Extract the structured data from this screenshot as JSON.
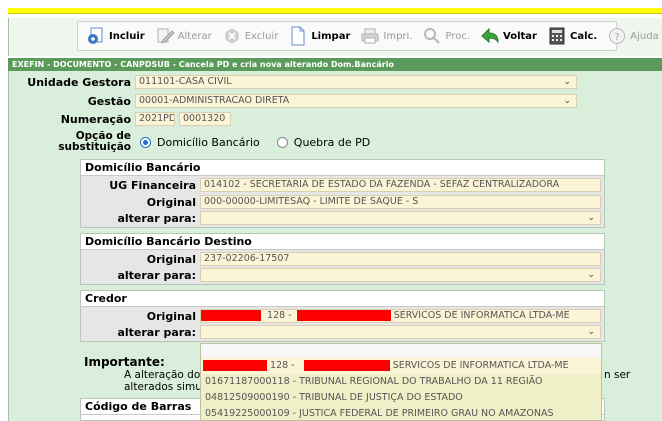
{
  "toolbar": {
    "buttons": [
      {
        "label": "Incluir",
        "icon": "add-document-icon",
        "enabled": true
      },
      {
        "label": "Alterar",
        "icon": "edit-icon",
        "enabled": false
      },
      {
        "label": "Excluir",
        "icon": "delete-icon",
        "enabled": false
      },
      {
        "label": "Limpar",
        "icon": "clear-icon",
        "enabled": true
      },
      {
        "label": "Impri.",
        "icon": "printer-icon",
        "enabled": false
      },
      {
        "label": "Proc.",
        "icon": "search-icon",
        "enabled": false
      },
      {
        "label": "Voltar",
        "icon": "back-arrow-icon",
        "enabled": true
      },
      {
        "label": "Calc.",
        "icon": "calculator-icon",
        "enabled": true
      },
      {
        "label": "Ajuda",
        "icon": "help-icon",
        "enabled": false
      }
    ]
  },
  "title": "EXEFIN - DOCUMENTO - CANPDSUB - Cancela PD e cria nova alterando Dom.Bancário",
  "form": {
    "unidade_gestora": {
      "label": "Unidade Gestora",
      "value": "011101-CASA CIVIL"
    },
    "gestao": {
      "label": "Gestão",
      "value": "00001-ADMINISTRACAO DIRETA"
    },
    "numeracao": {
      "label": "Numeração",
      "year": "2021PD",
      "number": "0001320"
    },
    "opcao": {
      "label_line1": "Opção de",
      "label_line2": "substituição",
      "option1": "Domicílio Bancário",
      "option2": "Quebra de PD",
      "selected": "Domicílio Bancário"
    }
  },
  "domicilio": {
    "title": "Domicílio Bancário",
    "ug_label": "UG Financeira",
    "ug_value": "014102 - SECRETARIA DE ESTADO DA FAZENDA - SEFAZ  CENTRALIZADORA",
    "original_label": "Original",
    "original_value": "000-00000-LIMITESAQ - LIMITE DE SAQUE - S",
    "alterar_label": "alterar para:"
  },
  "destino": {
    "title": "Domicílio Bancário Destino",
    "original_label": "Original",
    "original_value": "237-02206-17507",
    "alterar_label": "alterar para:"
  },
  "credor": {
    "title": "Credor",
    "original_label": "Original",
    "original_mid": "128 -",
    "original_suffix": "SERVICOS DE INFORMATICA LTDA-ME",
    "alterar_label": "alterar para:"
  },
  "importante": {
    "title": "Importante:",
    "line1_start": "A alteração dos",
    "line1_end": "n ser",
    "line2": "alterados simu"
  },
  "codigo_barras": {
    "title": "Código de Barras"
  },
  "dropdown_options": [
    {
      "mid": "128 -",
      "suffix": "SERVICOS DE INFORMATICA LTDA-ME",
      "redacted": true
    },
    {
      "text": "01671187000118 - TRIBUNAL REGIONAL DO TRABALHO DA 11 REGIÃO"
    },
    {
      "text": "04812509000190 - TRIBUNAL DE JUSTIÇA DO ESTADO"
    },
    {
      "text": "05419225000109 - JUSTICA FEDERAL DE PRIMEIRO GRAU NO AMAZONAS"
    }
  ],
  "colors": {
    "title_bar": "#5a9a5a",
    "form_bg": "#d9efdb",
    "field_bg": "#fbf4d6",
    "radio": "#1e6fd6",
    "redaction": "#ff0000"
  }
}
